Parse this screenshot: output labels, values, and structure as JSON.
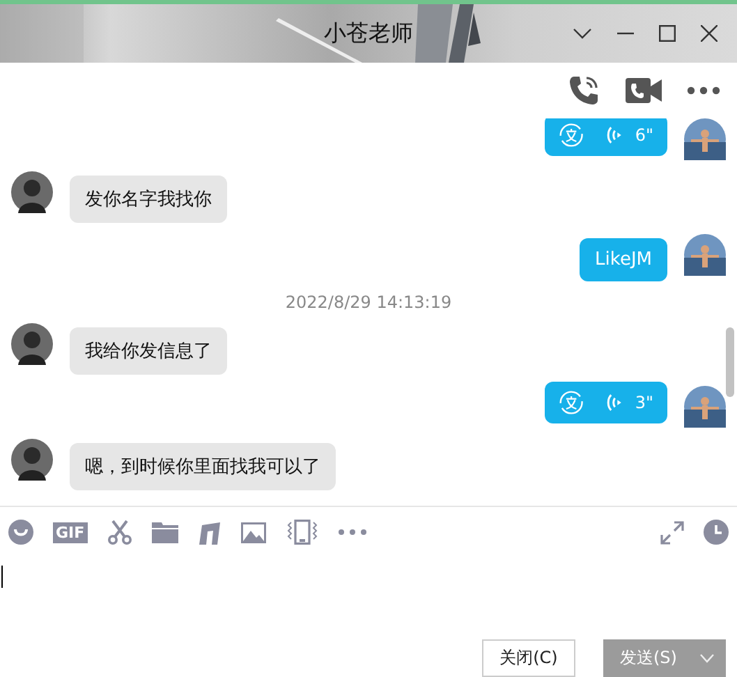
{
  "window": {
    "title": "小苍老师"
  },
  "messages": [
    {
      "kind": "voice",
      "outgoing": true,
      "duration": "6\""
    },
    {
      "kind": "text",
      "outgoing": false,
      "text": "发你名字我找你"
    },
    {
      "kind": "text",
      "outgoing": true,
      "text": "LikeJM"
    },
    {
      "kind": "time",
      "text": "2022/8/29 14:13:19"
    },
    {
      "kind": "text",
      "outgoing": false,
      "text": "我给你发信息了"
    },
    {
      "kind": "voice",
      "outgoing": true,
      "duration": "3\""
    },
    {
      "kind": "text",
      "outgoing": false,
      "text": "嗯，到时候你里面找我可以了"
    }
  ],
  "toolbar": {
    "gif_label": "GIF"
  },
  "buttons": {
    "close": "关闭(C)",
    "send": "发送(S)"
  }
}
